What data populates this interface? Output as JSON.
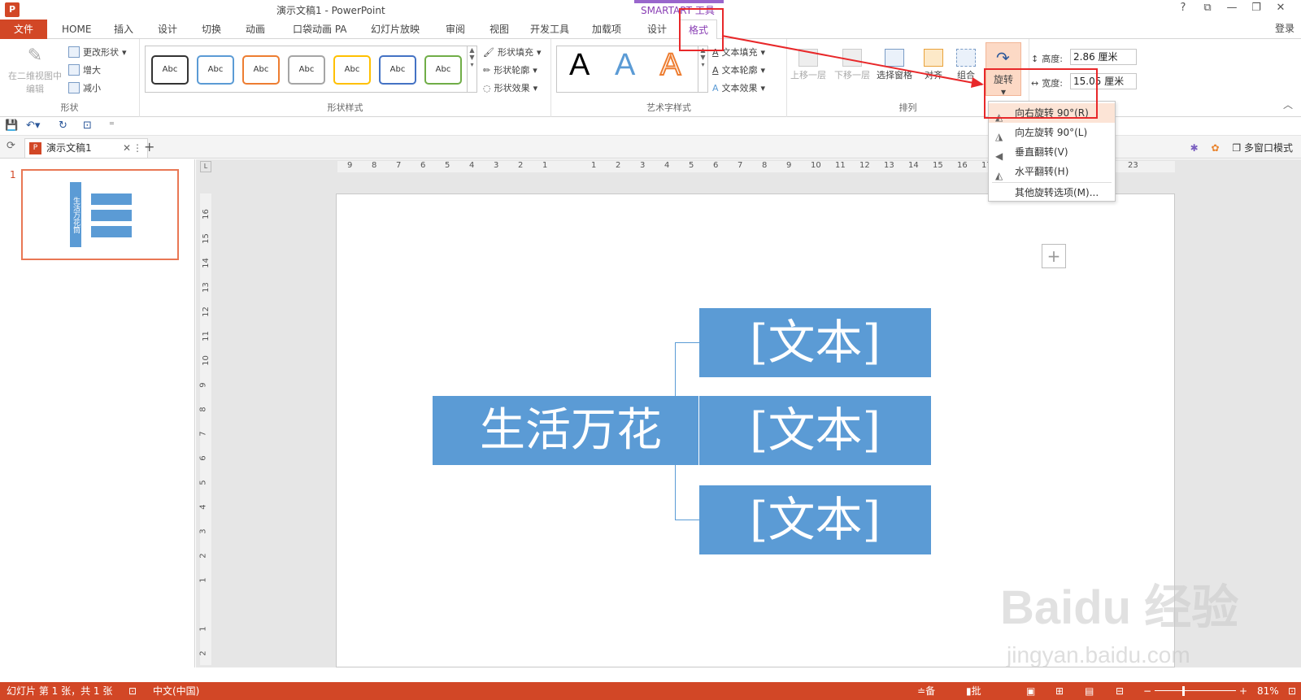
{
  "title": "演示文稿1 - PowerPoint",
  "contextual_tab": "SMARTART 工具",
  "window_buttons": [
    "?",
    "⧉",
    "—",
    "❐",
    "✕"
  ],
  "login": "登录",
  "tabs": [
    "文件",
    "HOME",
    "插入",
    "设计",
    "切换",
    "动画",
    "口袋动画 PA",
    "幻灯片放映",
    "审阅",
    "视图",
    "开发工具",
    "加载项",
    "设计",
    "格式"
  ],
  "ribbon": {
    "shape_group": {
      "edit_2d": "在二维视图中编辑",
      "change_shape": "更改形状",
      "larger": "增大",
      "smaller": "减小",
      "label": "形状"
    },
    "shape_styles": {
      "thumbnails": [
        "Abc",
        "Abc",
        "Abc",
        "Abc",
        "Abc",
        "Abc",
        "Abc"
      ],
      "thumb_colors": [
        "#333333",
        "#5b9bd5",
        "#ed7d31",
        "#a5a5a5",
        "#ffc000",
        "#4472c4",
        "#70ad47"
      ],
      "fill": "形状填充",
      "outline": "形状轮廓",
      "effects": "形状效果",
      "label": "形状样式"
    },
    "wordart": {
      "samples": [
        "A",
        "A",
        "A"
      ],
      "text_fill": "文本填充",
      "text_outline": "文本轮廓",
      "text_effects": "文本效果",
      "label": "艺术字样式"
    },
    "arrange": {
      "bring_forward": "上移一层",
      "send_backward": "下移一层",
      "selection_pane": "选择窗格",
      "align": "对齐",
      "group": "组合",
      "rotate": "旋转",
      "label": "排列"
    },
    "size": {
      "height_label": "高度:",
      "height_value": "2.86 厘米",
      "width_label": "宽度:",
      "width_value": "15.05 厘米"
    }
  },
  "rotate_menu": [
    {
      "label": "向右旋转 90°(R)",
      "icon": "rotate-right-icon",
      "highlighted": true
    },
    {
      "label": "向左旋转 90°(L)",
      "icon": "rotate-left-icon",
      "highlighted": false
    },
    {
      "label": "垂直翻转(V)",
      "icon": "flip-vertical-icon",
      "highlighted": false
    },
    {
      "label": "水平翻转(H)",
      "icon": "flip-horizontal-icon",
      "highlighted": false
    },
    {
      "label": "其他旋转选项(M)...",
      "icon": "",
      "highlighted": false
    }
  ],
  "doc_tab": {
    "name": "演示文稿1",
    "multi_window": "多窗口模式"
  },
  "thumbnail": {
    "number": "1",
    "main_text": "生活万花筒"
  },
  "hruler_labels": [
    "9",
    "8",
    "7",
    "6",
    "5",
    "4",
    "3",
    "2",
    "1",
    "",
    "1",
    "2",
    "3",
    "4",
    "5",
    "6",
    "7",
    "8",
    "9",
    "10",
    "11",
    "12",
    "13",
    "14",
    "15",
    "16",
    "17",
    "18",
    "19",
    "20",
    "21",
    "22",
    "23"
  ],
  "vruler_labels": [
    "16",
    "15",
    "14",
    "13",
    "12",
    "11",
    "10",
    "9",
    "8",
    "7",
    "6",
    "5",
    "4",
    "3",
    "2",
    "1",
    "",
    "1",
    "2"
  ],
  "smartart": {
    "main": "生活万花",
    "children": [
      "[文本]",
      "[文本]",
      "[文本]"
    ]
  },
  "watermark": {
    "brand": "Baidu 经验",
    "url": "jingyan.baidu.com"
  },
  "status": {
    "slide_info": "幻灯片 第 1 张，共 1 张",
    "language": "中文(中国)",
    "notes": "备注",
    "comments": "批注",
    "zoom": "81%"
  },
  "colors": {
    "accent": "#d24726",
    "smartart_fill": "#5b9bd5",
    "annotation_red": "#e8282a",
    "contextual_purple": "#8a3fb5"
  }
}
